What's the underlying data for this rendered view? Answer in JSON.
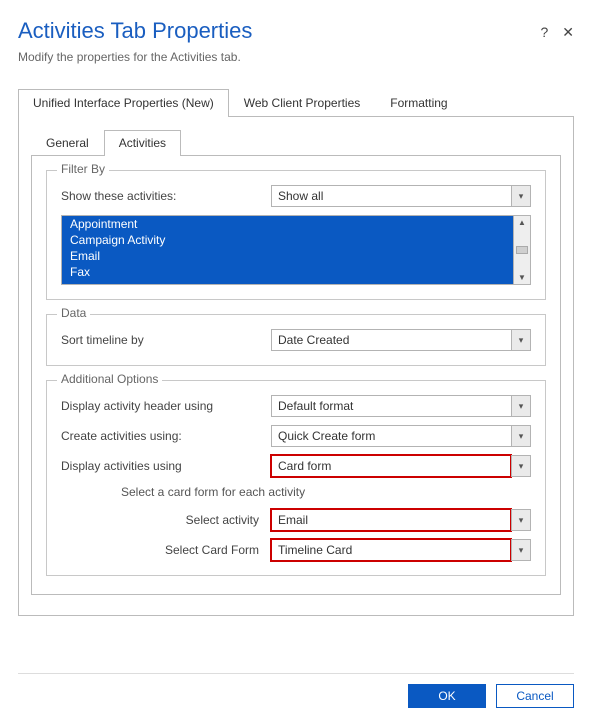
{
  "header": {
    "title": "Activities Tab Properties",
    "subtitle": "Modify the properties for the Activities tab.",
    "help_label": "?",
    "close_label": "✕"
  },
  "outer_tabs": {
    "t0": "Unified Interface Properties (New)",
    "t1": "Web Client Properties",
    "t2": "Formatting"
  },
  "inner_tabs": {
    "t0": "General",
    "t1": "Activities"
  },
  "filter_by": {
    "legend": "Filter By",
    "show_label": "Show these activities:",
    "show_value": "Show all",
    "items": {
      "i0": "Appointment",
      "i1": "Campaign Activity",
      "i2": "Email",
      "i3": "Fax"
    }
  },
  "data_group": {
    "legend": "Data",
    "sort_label": "Sort timeline by",
    "sort_value": "Date Created"
  },
  "additional": {
    "legend": "Additional Options",
    "header_label": "Display activity header using",
    "header_value": "Default format",
    "create_label": "Create activities using:",
    "create_value": "Quick Create form",
    "display_label": "Display activities using",
    "display_value": "Card form",
    "subnote": "Select a card form for each activity",
    "sel_activity_label": "Select activity",
    "sel_activity_value": "Email",
    "sel_cardform_label": "Select Card Form",
    "sel_cardform_value": "Timeline Card"
  },
  "footer": {
    "ok": "OK",
    "cancel": "Cancel"
  }
}
